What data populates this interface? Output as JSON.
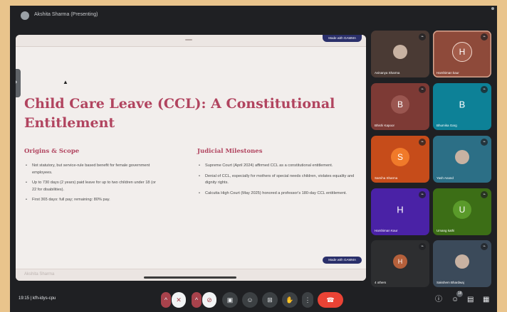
{
  "presenter": {
    "label": "Akshita Sharma (Presenting)"
  },
  "slide": {
    "made_with_top": "Made with GAMMA",
    "made_with_bottom": "Made with GAMMA",
    "title": "Child Care Leave (CCL): A Constitutional Entitlement",
    "left_heading": "Origins & Scope",
    "left_bullets": [
      "Not statutory, but service-rule based benefit for female government employees.",
      "Up to 730 days (2 years) paid leave for up to two children under 18 (or 22 for disabilities).",
      "First 365 days: full pay; remaining: 80% pay."
    ],
    "right_heading": "Judicial Milestones",
    "right_bullets": [
      "Supreme Court (April 2024) affirmed CCL as a constitutional entitlement.",
      "Denial of CCL, especially for mothers of special needs children, violates equality and dignity rights.",
      "Calcutta High Court (May 2025) honored a professor's 180-day CCL entitlement."
    ],
    "footer_name": "Akshita Sharma"
  },
  "participants": [
    {
      "name": "Avinanya Sharma",
      "kind": "photo",
      "bg": "#4a3a34"
    },
    {
      "name": "Harshiman kaur",
      "kind": "initial",
      "initial": "H",
      "bg": "#8e4a3a",
      "circle": "#a35c4a"
    },
    {
      "name": "Bhishi Kapoor",
      "kind": "initial",
      "initial": "B",
      "bg": "#7d3a35",
      "circle": "#9a5650"
    },
    {
      "name": "Bhumika Garg",
      "kind": "letter",
      "initial": "B",
      "bg": "#0d8197"
    },
    {
      "name": "Samiha Sharma",
      "kind": "initial",
      "initial": "S",
      "bg": "#c64c1a",
      "circle": "#f07a2a"
    },
    {
      "name": "Yash Anand",
      "kind": "photo",
      "bg": "#2c6f86"
    },
    {
      "name": "Harshiman Kaur",
      "kind": "letter",
      "initial": "H",
      "bg": "#4a22a6"
    },
    {
      "name": "Umang kathi",
      "kind": "initial",
      "initial": "U",
      "bg": "#3c6e16",
      "circle": "#5a9a2a"
    },
    {
      "name": "4 others",
      "kind": "others",
      "initial": "H",
      "bg": "#2d2e30"
    },
    {
      "name": "Sakshem Bhardwaj",
      "kind": "photo",
      "bg": "#3b4a5a"
    }
  ],
  "tile_badge": "⌁",
  "meeting": {
    "time": "19:15",
    "code": "kfh-idys-cpu"
  },
  "controls": {
    "mic_chevron": "^",
    "mic_icon": "✕",
    "cam_chevron": "^",
    "cam_icon": "⊘",
    "captions": "▣",
    "emoji": "☺",
    "present": "⊞",
    "raise_hand": "✋",
    "more": "⋮",
    "end_call": "☎"
  },
  "right_controls": {
    "info": "ⓘ",
    "people": "☺",
    "people_count": "18",
    "chat": "▤",
    "activities": "▦"
  }
}
